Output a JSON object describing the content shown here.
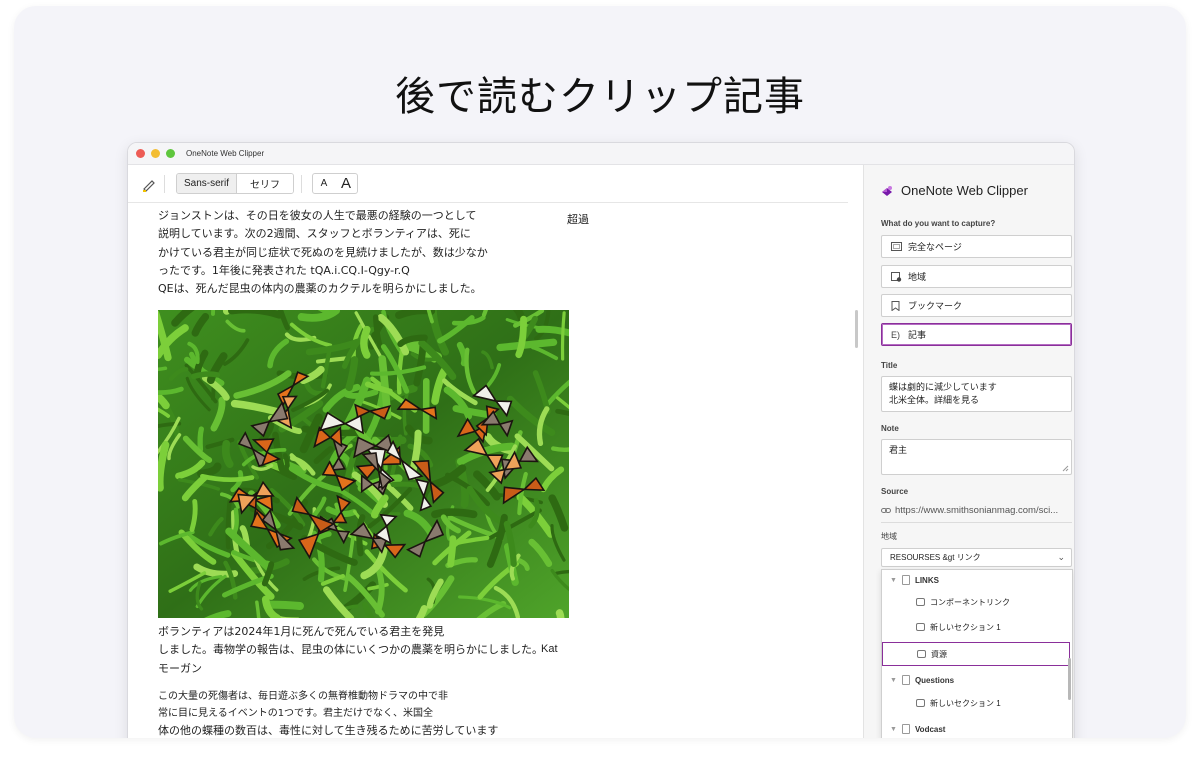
{
  "headline": "後で読むクリップ記事",
  "window": {
    "title": "OneNote Web Clipper"
  },
  "toolbar": {
    "font_sans": "Sans-serif",
    "font_serif": "セリフ",
    "size_small": "A",
    "size_large": "A"
  },
  "article": {
    "lines": [
      "ジョンストンは、その日を彼女の人生で最悪の経験の一つとして",
      "説明しています。次の2週間、スタッフとボランティアは、死に",
      "かけている君主が同じ症状で死ぬのを見続けましたが、数は少なか",
      "ったです。1年後に発表された tQA.i.CQ.I-Qgy-r.Q",
      "QEは、死んだ昆虫の体内の農薬のカクテルを明らかにしました。"
    ],
    "aside_word": "超過",
    "caption_lines": [
      "ボランティアは2024年1月に死んで死んでいる君主を発見",
      "しました。毒物学の報告は、昆虫の体にいくつかの農薬を明らかにしました。",
      "モーガン"
    ],
    "caption_credit": "Kat",
    "body2_lines": [
      "この大量の死傷者は、毎日遊ぶ多くの無脊椎動物ドラマの中で非",
      "常に目に見えるイベントの1つです。君主だけでなく、米国全",
      "体の他の蝶種の数百は、毒性に対して生き残るために苦労しています"
    ]
  },
  "panel": {
    "title": "OneNote Web Clipper",
    "capture_label": "What do you want to capture?",
    "options": [
      {
        "label": "完全なページ",
        "icon": "full-page-icon"
      },
      {
        "label": "地域",
        "icon": "region-icon"
      },
      {
        "label": "ブックマーク",
        "icon": "bookmark-icon"
      },
      {
        "label": "記事",
        "icon": "article-icon",
        "prefix": "E)"
      }
    ],
    "title_label": "Title",
    "title_value_1": "蝶は劇的に減少しています",
    "title_value_2": "北米全体。詳細を見る",
    "note_label": "Note",
    "note_value": "君主",
    "source_label": "Source",
    "source_value": "https://www.smithsonianmag.com/sci...",
    "location_label": "地域",
    "location_value": "RESOURSES &gt リンク",
    "dropdown": [
      {
        "type": "group",
        "label": "LINKS"
      },
      {
        "type": "section",
        "label": "コンポーネントリンク"
      },
      {
        "type": "section",
        "label": "新しいセクション 1"
      },
      {
        "type": "section",
        "label": "資源",
        "selected": true
      },
      {
        "type": "group",
        "label": "Questions"
      },
      {
        "type": "section",
        "label": "新しいセクション 1"
      },
      {
        "type": "group",
        "label": "Vodcast"
      }
    ]
  },
  "colors": {
    "accent": "#8a2f9a",
    "onenote": "#7719aa"
  }
}
